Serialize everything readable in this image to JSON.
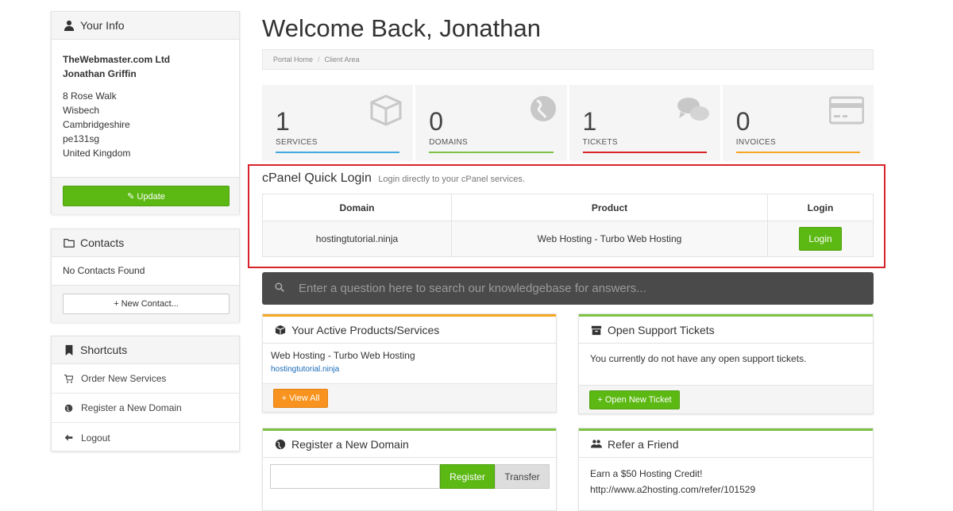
{
  "sidebar": {
    "your_info": {
      "title": "Your Info",
      "company": "TheWebmaster.com Ltd",
      "name": "Jonathan Griffin",
      "address": [
        "8 Rose Walk",
        "Wisbech",
        "Cambridgeshire",
        "pe131sg",
        "United Kingdom"
      ],
      "update_label": "✎ Update"
    },
    "contacts": {
      "title": "Contacts",
      "empty_text": "No Contacts Found",
      "new_label": "+ New Contact..."
    },
    "shortcuts": {
      "title": "Shortcuts",
      "items": [
        {
          "label": "Order New Services",
          "icon": "cart-icon"
        },
        {
          "label": "Register a New Domain",
          "icon": "globe-icon"
        },
        {
          "label": "Logout",
          "icon": "arrow-left-icon"
        }
      ]
    }
  },
  "main": {
    "title": "Welcome Back, Jonathan",
    "breadcrumb": [
      "Portal Home",
      "Client Area"
    ],
    "stats": [
      {
        "value": "1",
        "label": "SERVICES",
        "color": "#3fa9e0",
        "icon": "cube-icon"
      },
      {
        "value": "0",
        "label": "DOMAINS",
        "color": "#7dc242",
        "icon": "globe-icon"
      },
      {
        "value": "1",
        "label": "TICKETS",
        "color": "#d8232a",
        "icon": "comments-icon"
      },
      {
        "value": "0",
        "label": "INVOICES",
        "color": "#f5a623",
        "icon": "credit-card-icon"
      }
    ],
    "cpanel": {
      "title": "cPanel Quick Login",
      "subtitle": "Login directly to your cPanel services.",
      "headers": [
        "Domain",
        "Product",
        "Login"
      ],
      "rows": [
        {
          "domain": "hostingtutorial.ninja",
          "product": "Web Hosting - Turbo Web Hosting",
          "login_label": "Login"
        }
      ]
    },
    "kb_search": {
      "placeholder": "Enter a question here to search our knowledgebase for answers..."
    },
    "products": {
      "title": "Your Active Products/Services",
      "item_name": "Web Hosting - Turbo Web Hosting",
      "item_domain": "hostingtutorial.ninja",
      "view_all_label": "+ View All"
    },
    "tickets": {
      "title": "Open Support Tickets",
      "body": "You currently do not have any open support tickets.",
      "open_label": "+ Open New Ticket"
    },
    "domain": {
      "title": "Register a New Domain",
      "register_label": "Register",
      "transfer_label": "Transfer"
    },
    "refer": {
      "title": "Refer a Friend",
      "line1": "Earn a $50 Hosting Credit!",
      "line2": "http://www.a2hosting.com/refer/101529"
    }
  },
  "colors": {
    "green": "#5cb813",
    "orange": "#f7931e",
    "highlight_red": "#d8232a",
    "search_bg": "#4a4a4a"
  }
}
